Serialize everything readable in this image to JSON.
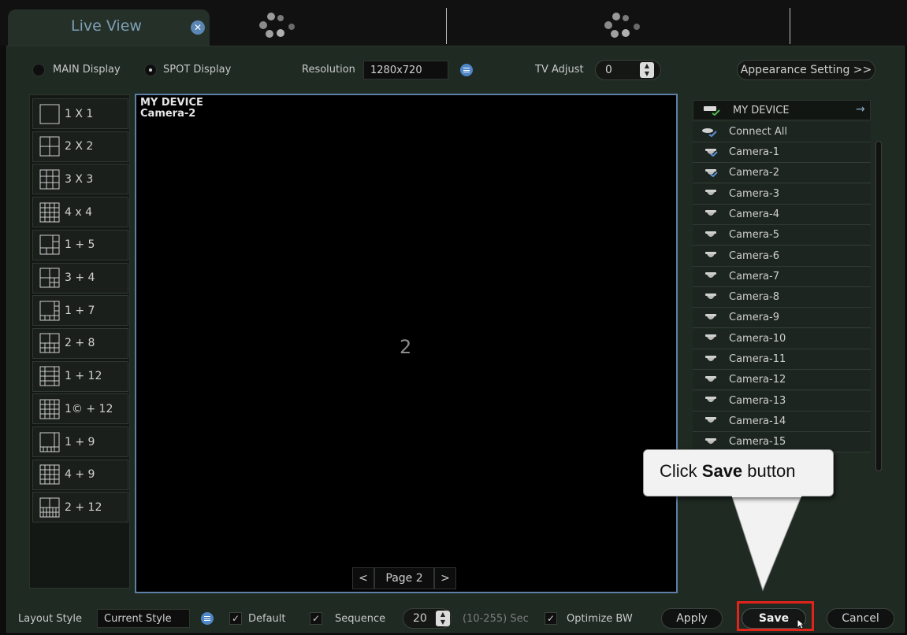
{
  "tabs": {
    "active_label": "Live View",
    "close_icon": "close-icon"
  },
  "top": {
    "main_display_label": "MAIN Display",
    "spot_display_label": "SPOT Display",
    "selected_display": "SPOT Display",
    "resolution_label": "Resolution",
    "resolution_value": "1280x720",
    "tv_adjust_label": "TV Adjust",
    "tv_adjust_value": "0",
    "appearance_button": "Appearance Setting >>"
  },
  "layouts": [
    {
      "label": "1 X 1",
      "icon": "layout-1x1-icon"
    },
    {
      "label": "2 X 2",
      "icon": "layout-2x2-icon"
    },
    {
      "label": "3 X 3",
      "icon": "layout-3x3-icon"
    },
    {
      "label": "4 x 4",
      "icon": "layout-4x4-icon"
    },
    {
      "label": "1 + 5",
      "icon": "layout-1plus5-icon"
    },
    {
      "label": "3 + 4",
      "icon": "layout-3plus4-icon"
    },
    {
      "label": "1 + 7",
      "icon": "layout-1plus7-icon"
    },
    {
      "label": "2 + 8",
      "icon": "layout-2plus8-icon"
    },
    {
      "label": "1 + 12",
      "icon": "layout-1plus12-icon"
    },
    {
      "label": "1© + 12",
      "icon": "layout-1c-plus12-icon"
    },
    {
      "label": "1 + 9",
      "icon": "layout-1plus9-icon"
    },
    {
      "label": "4 + 9",
      "icon": "layout-4plus9-icon"
    },
    {
      "label": "2 + 12",
      "icon": "layout-2plus12-icon"
    }
  ],
  "video": {
    "overlay_device": "MY DEVICE",
    "overlay_camera": "Camera-2",
    "channel_number": "2",
    "page_label": "Page 2",
    "prev": "<",
    "next": ">"
  },
  "devices": {
    "head_label": "MY DEVICE",
    "connect_all": "Connect All",
    "cameras": [
      "Camera-1",
      "Camera-2",
      "Camera-3",
      "Camera-4",
      "Camera-5",
      "Camera-6",
      "Camera-7",
      "Camera-8",
      "Camera-9",
      "Camera-10",
      "Camera-11",
      "Camera-12",
      "Camera-13",
      "Camera-14",
      "Camera-15"
    ],
    "connected": [
      "Camera-1",
      "Camera-2"
    ]
  },
  "callout": {
    "prefix": "Click ",
    "bold": "Save",
    "suffix": " button"
  },
  "bottom": {
    "layout_style_label": "Layout Style",
    "layout_style_value": "Current Style",
    "default_label": "Default",
    "sequence_label": "Sequence",
    "sequence_value": "20",
    "range_hint": "(10-255) Sec",
    "optimize_label": "Optimize BW",
    "apply": "Apply",
    "save": "Save",
    "cancel": "Cancel"
  },
  "colors": {
    "accent_blue": "#4e86c6",
    "highlight_red": "#e2231a",
    "panel": "#1f2a22"
  }
}
